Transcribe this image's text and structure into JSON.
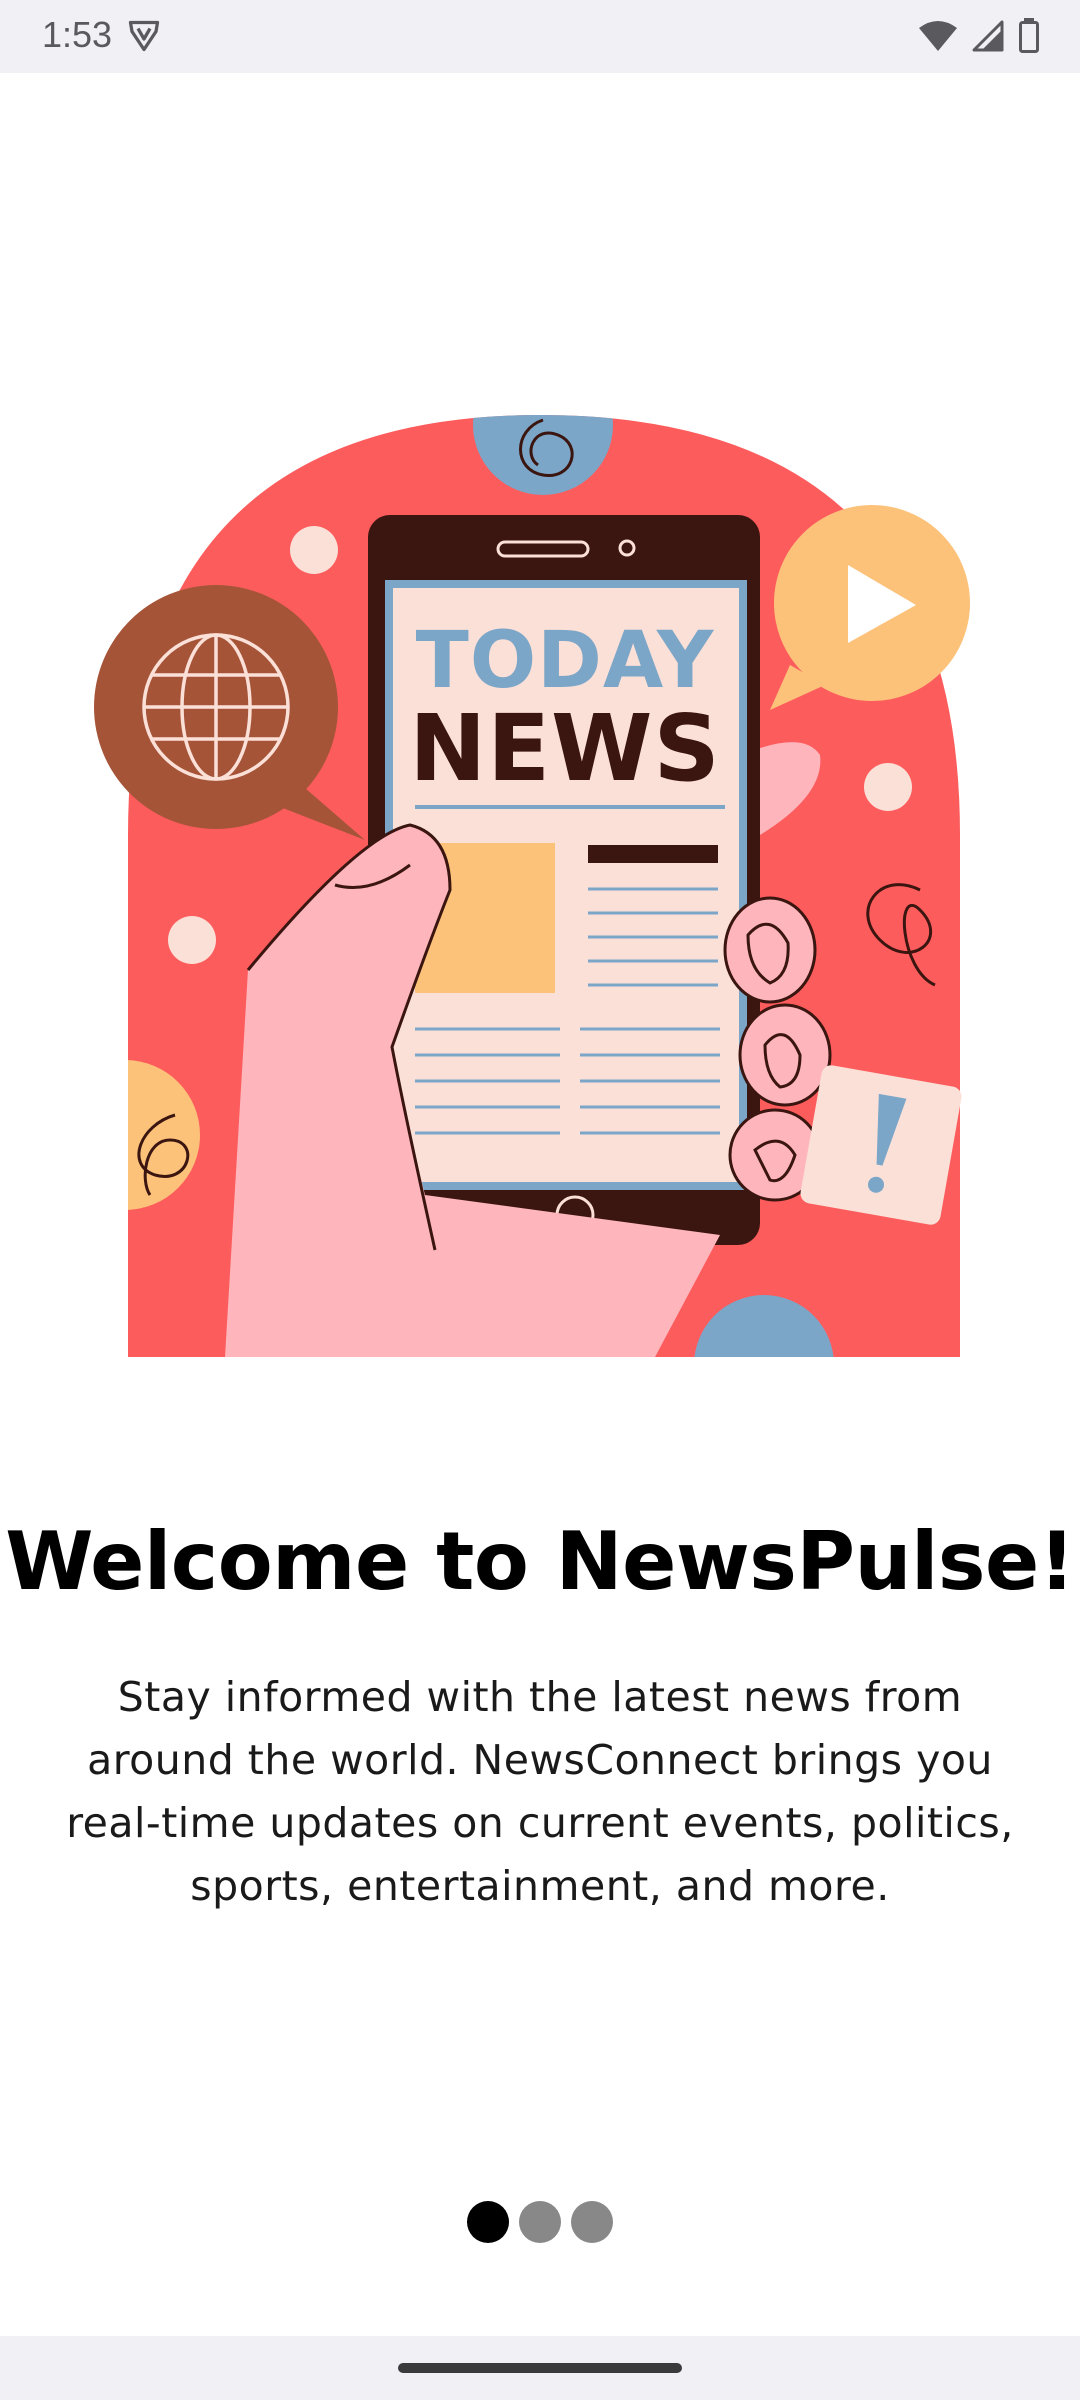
{
  "status_bar": {
    "time": "1:53",
    "left_icon": "shield-v-icon",
    "right_icons": [
      "wifi-icon",
      "signal-icon",
      "battery-icon"
    ]
  },
  "illustration": {
    "screen_line1": "TODAY",
    "screen_line2": "NEWS",
    "colors": {
      "arch": "#fd5c5d",
      "phone": "#3b1510",
      "screen": "#fbe0d8",
      "accent_blue": "#7ba6c8",
      "accent_orange": "#fdc27a",
      "hand": "#feb6bc",
      "bubble_brown": "#a65438"
    }
  },
  "onboarding": {
    "title": "Welcome to NewsPulse!",
    "description": "Stay informed with the latest news from around the world. NewsConnect brings you real-time updates on current events, politics, sports, entertainment, and more.",
    "page_count": 3,
    "current_page": 1
  },
  "nav_bar": {
    "handle": "home-gesture-handle"
  }
}
